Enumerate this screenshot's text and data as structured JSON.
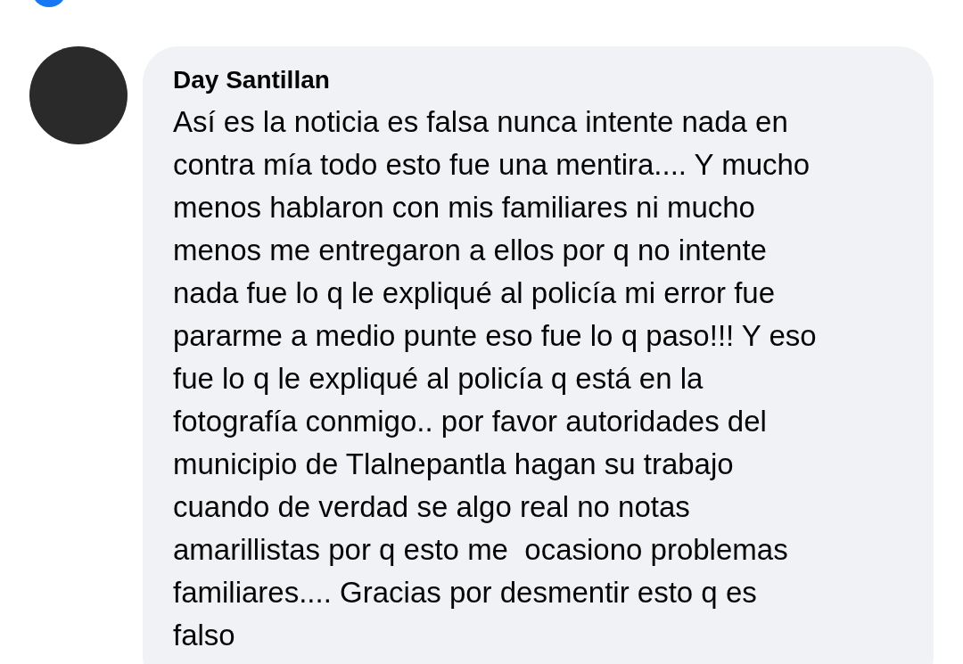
{
  "comment": {
    "author": "Day Santillan",
    "lines": [
      "Así es la noticia es falsa nunca intente nada en",
      "contra mía todo esto fue una mentira.... Y mucho",
      "menos hablaron con mis familiares ni mucho",
      "menos me entregaron a ellos por q no intente",
      "nada fue lo q le expliqué al policía mi error fue",
      "pararme a medio punte eso fue lo q paso!!! Y eso",
      "fue lo q le expliqué al policía q está en la",
      "fotografía conmigo.. por favor autoridades del",
      "municipio de Tlalnepantla hagan su trabajo",
      "cuando de verdad se algo real no notas",
      "amarillistas por q esto me  ocasiono problemas",
      "familiares.... Gracias por desmentir esto q es",
      "falso"
    ]
  }
}
